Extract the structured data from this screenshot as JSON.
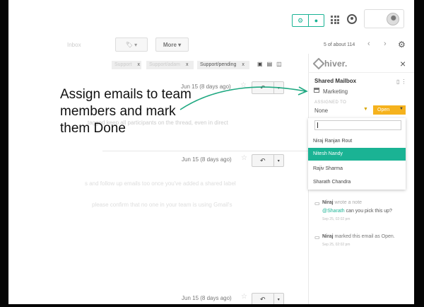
{
  "app": {
    "pager": "5 of about 114",
    "toolbar": {
      "more_label": "More ▾",
      "left_fade_text": "Inbox"
    },
    "labels": [
      {
        "text": "Support"
      },
      {
        "text": "Support/adam"
      },
      {
        "text": "Support/pending"
      }
    ]
  },
  "emails": {
    "date_1": "Jun 15 (8 days ago)",
    "date_2": "Jun 15 (8 days ago)",
    "date_3": "Jun 15 (8 days ago)",
    "body_1_prefix": "tagged keep all participants on the thread, even in direct",
    "body_2": "s and follow up emails too once you've added a shared label",
    "body_3": "please confirm that no one in your team is using Gmail's"
  },
  "callout": {
    "text": "Assign emails to team members and mark them Done"
  },
  "hiver": {
    "brand": "hiver.",
    "shared_mailbox_title": "Shared Mailbox",
    "mailbox_name": "Marketing",
    "assigned_to_label": "ASSIGNED TO",
    "assignee": "None",
    "status": "Open",
    "dropdown_items": [
      "Niraj Ranjan Rout",
      "Nitesh Nandy",
      "Rajiv Sharma",
      "Sharath Chandra"
    ],
    "activity": {
      "note_author": "Niraj",
      "note_action": "wrote a note",
      "mention": "@Sharath",
      "note_text": "can you pick this up?",
      "note_time": "Sep 25, 02:02 pm",
      "marked_author": "Niraj",
      "marked_text": "marked this email as Open.",
      "marked_time": "Sep 25, 02:02 pm"
    }
  },
  "colors": {
    "accent_teal": "#1ab394",
    "status_yellow": "#f5b21d"
  },
  "icons": {
    "hiver_toggle_left": "gear-icon",
    "hiver_toggle_right": "bell-icon",
    "apps": "apps-grid-icon",
    "account": "account-icon",
    "settings": "gear-icon",
    "close": "close-icon",
    "reply": "reply-icon"
  }
}
